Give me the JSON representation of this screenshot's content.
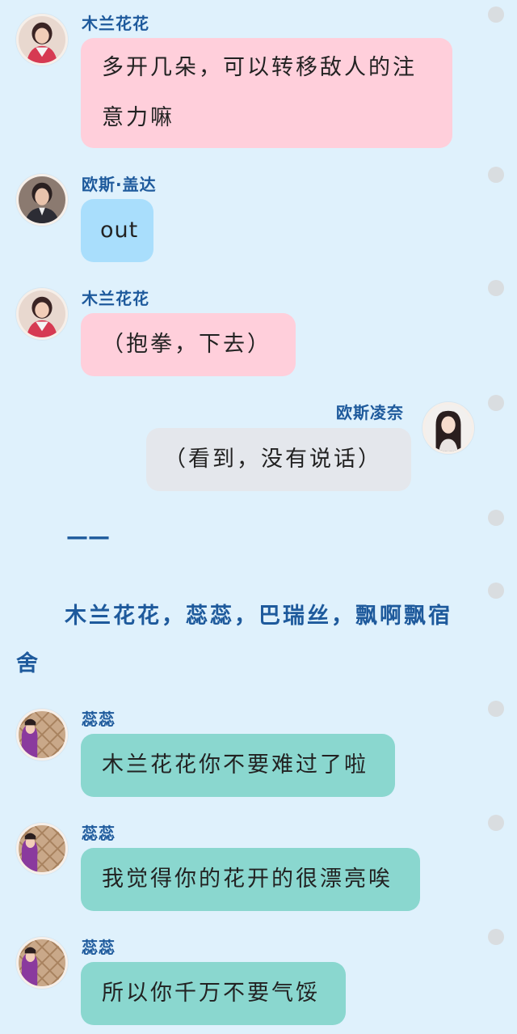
{
  "messages": [
    {
      "sender": "木兰花花",
      "line1": "多开几朵，可以转移敌人的注",
      "line2": "意力嘛"
    },
    {
      "sender": "欧斯·盖达",
      "text": "out"
    },
    {
      "sender": "木兰花花",
      "text": "（抱拳，下去）"
    },
    {
      "sender": "欧斯凌奈",
      "text": "（看到，没有说话）"
    },
    {
      "sender": "蕊蕊",
      "text": "木兰花花你不要难过了啦"
    },
    {
      "sender": "蕊蕊",
      "text": "我觉得你的花开的很漂亮唉"
    },
    {
      "sender": "蕊蕊",
      "text": "所以你千万不要气馁"
    }
  ],
  "narration": {
    "dashes": "——",
    "line1": "木兰花花，蕊蕊，巴瑞丝，飘啊飘宿",
    "line2": "舍"
  },
  "colors": {
    "background": "#dff1fc",
    "name": "#1e5a9c",
    "pink_bubble": "#ffcfdb",
    "blue_bubble": "#a9defc",
    "grey_bubble": "#e4e7ec",
    "teal_bubble": "#8ad7cf"
  }
}
